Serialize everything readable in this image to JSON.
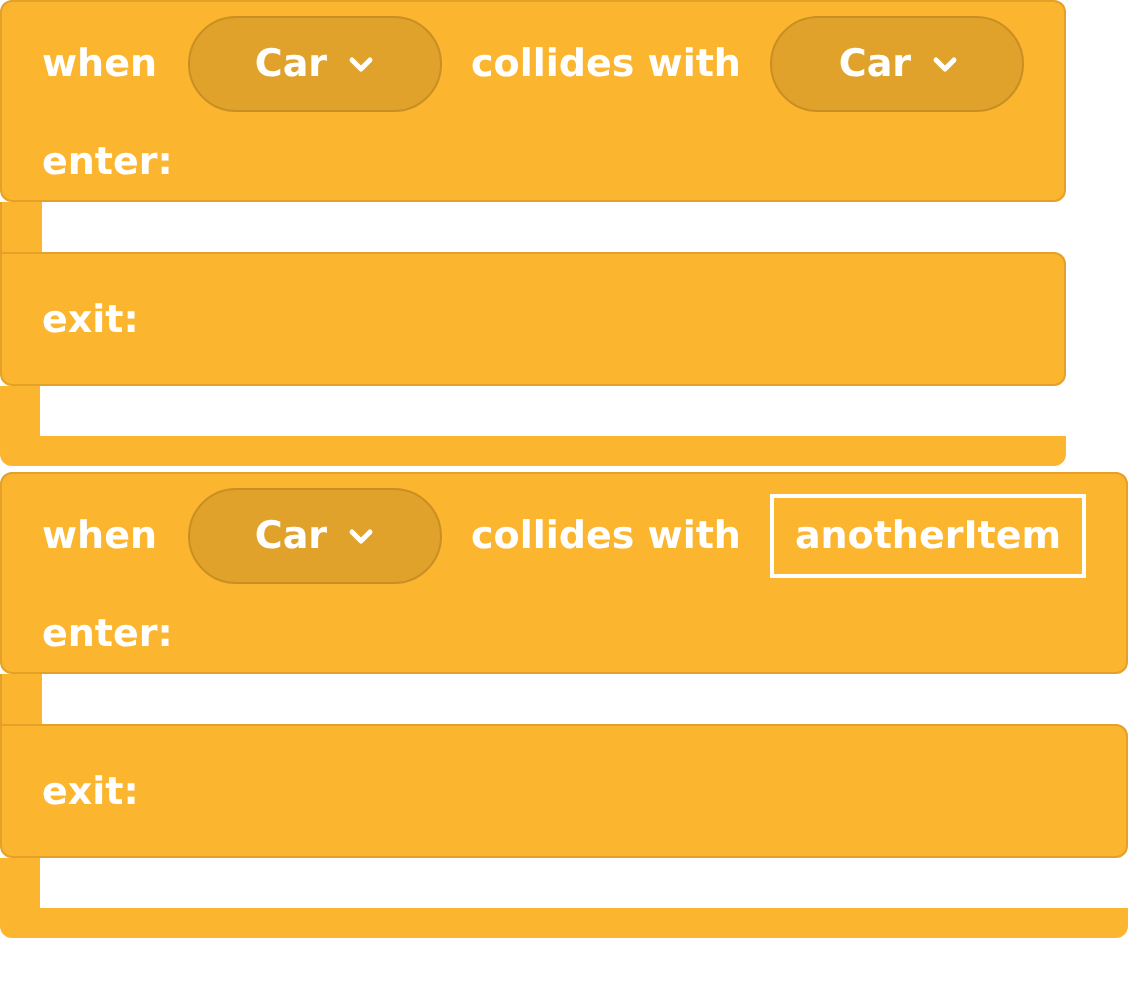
{
  "blocks": [
    {
      "when": "when",
      "subject": {
        "kind": "dropdown",
        "label": "Car"
      },
      "collides": "collides with",
      "other": {
        "kind": "dropdown",
        "label": "Car"
      },
      "enter": "enter:",
      "exit": "exit:"
    },
    {
      "when": "when",
      "subject": {
        "kind": "dropdown",
        "label": "Car"
      },
      "collides": "collides with",
      "other": {
        "kind": "text",
        "label": "anotherItem"
      },
      "enter": "enter:",
      "exit": "exit:"
    }
  ]
}
